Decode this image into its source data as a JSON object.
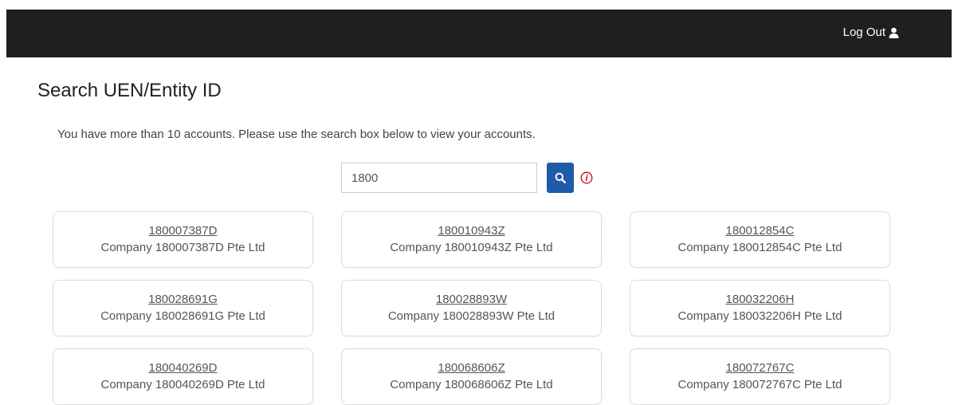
{
  "header": {
    "logout_label": "Log Out",
    "logout_icon": "user-icon"
  },
  "page": {
    "title": "Search UEN/Entity ID",
    "info_text": "You have more than 10 accounts. Please use the search box below to view your accounts."
  },
  "search": {
    "value": "1800",
    "button_icon": "search-icon",
    "info_icon": "info-icon",
    "accent_color": "#1e5ba8",
    "info_color": "#d0021b"
  },
  "accounts": [
    {
      "id": "180007387D",
      "name": "Company 180007387D Pte Ltd"
    },
    {
      "id": "180010943Z",
      "name": "Company 180010943Z Pte Ltd"
    },
    {
      "id": "180012854C",
      "name": "Company 180012854C Pte Ltd"
    },
    {
      "id": "180028691G",
      "name": "Company 180028691G Pte Ltd"
    },
    {
      "id": "180028893W",
      "name": "Company 180028893W Pte Ltd"
    },
    {
      "id": "180032206H",
      "name": "Company 180032206H Pte Ltd"
    },
    {
      "id": "180040269D",
      "name": "Company 180040269D Pte Ltd"
    },
    {
      "id": "180068606Z",
      "name": "Company 180068606Z Pte Ltd"
    },
    {
      "id": "180072767C",
      "name": "Company 180072767C Pte Ltd"
    }
  ]
}
